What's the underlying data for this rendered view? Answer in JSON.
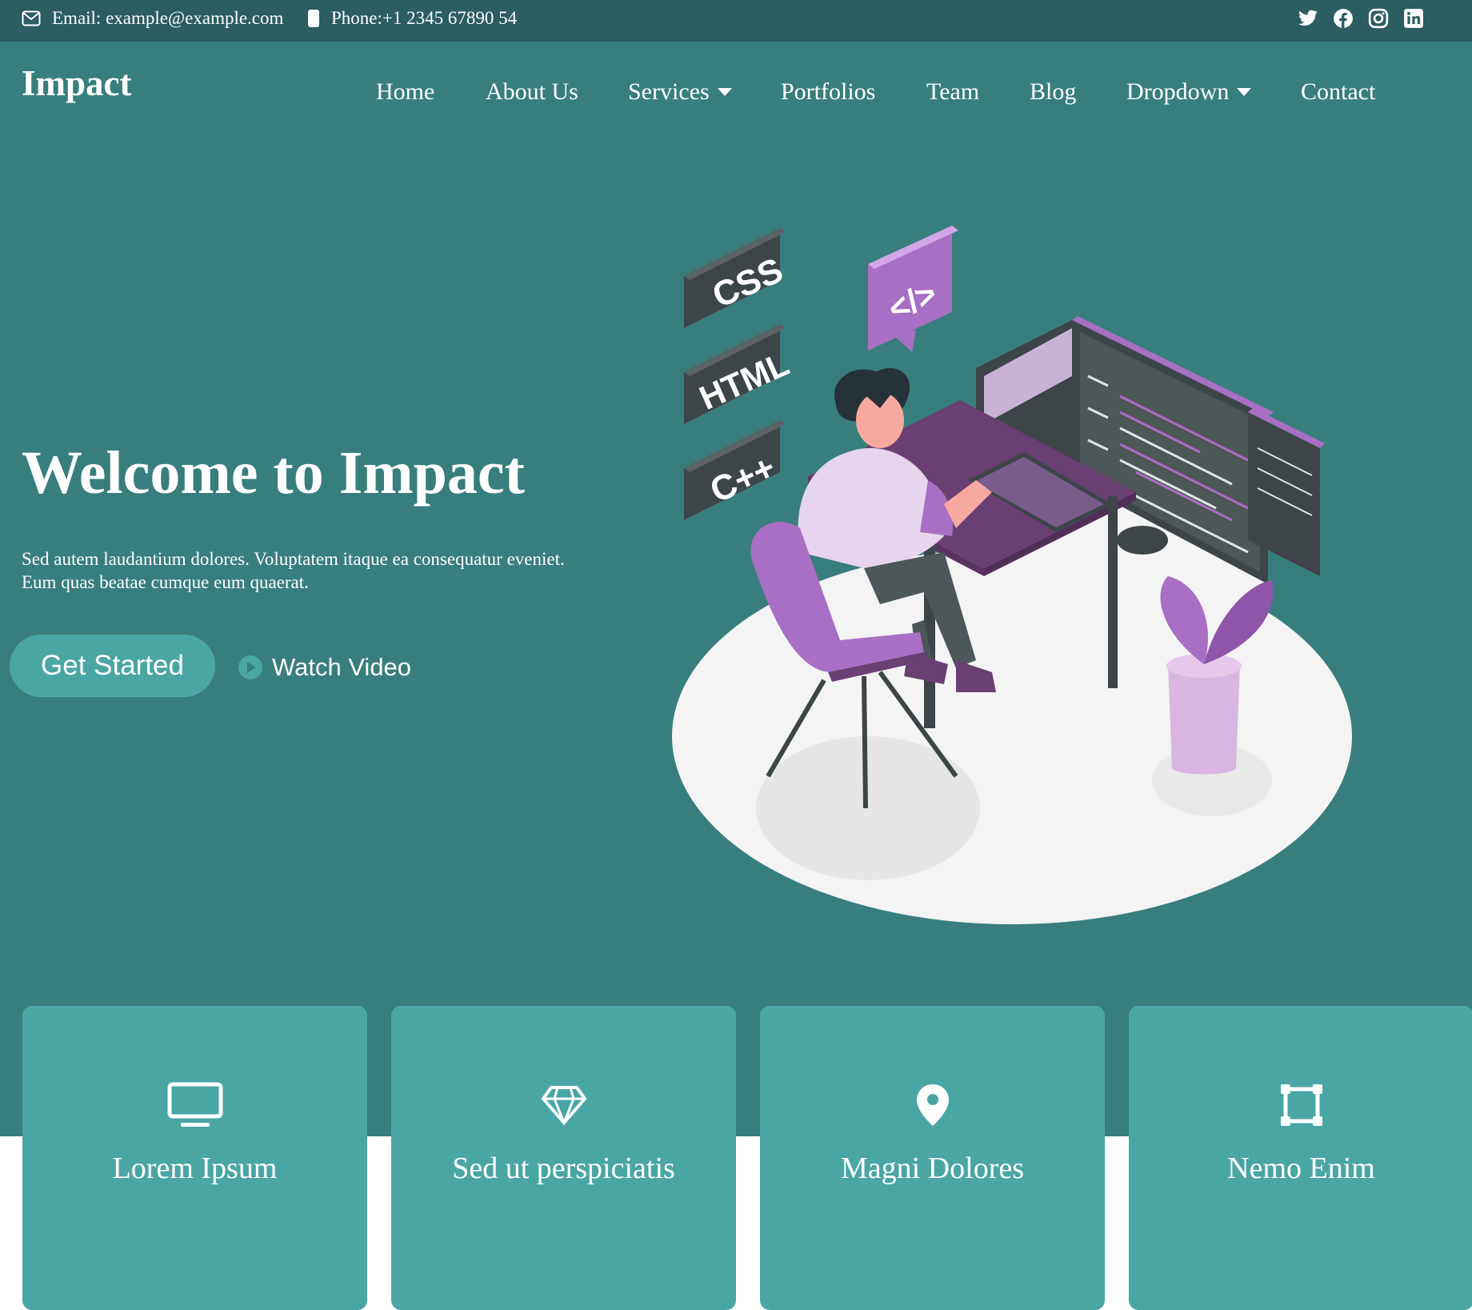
{
  "topbar": {
    "email": "Email: example@example.com",
    "phone": "Phone:+1 2345 67890 54",
    "social_icons": [
      "twitter-icon",
      "facebook-icon",
      "instagram-icon",
      "linkedin-icon"
    ]
  },
  "header": {
    "logo": "Impact",
    "nav": [
      {
        "label": "Home"
      },
      {
        "label": "About Us"
      },
      {
        "label": "Services"
      },
      {
        "label": "Portfolios"
      },
      {
        "label": "Team"
      },
      {
        "label": "Blog"
      },
      {
        "label": "Dropdown"
      },
      {
        "label": "Contact"
      }
    ]
  },
  "hero": {
    "title": "Welcome to Impact",
    "subtitle_line1": "Sed autem laudantium dolores. Voluptatem itaque ea consequatur eveniet.",
    "subtitle_line2": "Eum quas beatae cumque eum quaerat.",
    "cta": "Get Started",
    "video": "Watch Video",
    "illustration_labels": [
      "CSS",
      "HTML",
      "C++",
      "</>"
    ]
  },
  "cards": [
    {
      "title": "Lorem Ipsum",
      "icon": "monitor-icon"
    },
    {
      "title": "Sed ut perspiciatis",
      "icon": "diamond-icon"
    },
    {
      "title": "Magni Dolores",
      "icon": "map-pin-icon"
    },
    {
      "title": "Nemo Enim",
      "icon": "bounding-box-icon"
    }
  ],
  "colors": {
    "topbar": "#2b5d61",
    "hero": "#387e7d",
    "accent": "#4aa6a5",
    "purple": "#a86fc4",
    "dark_purple": "#6a3f74"
  }
}
